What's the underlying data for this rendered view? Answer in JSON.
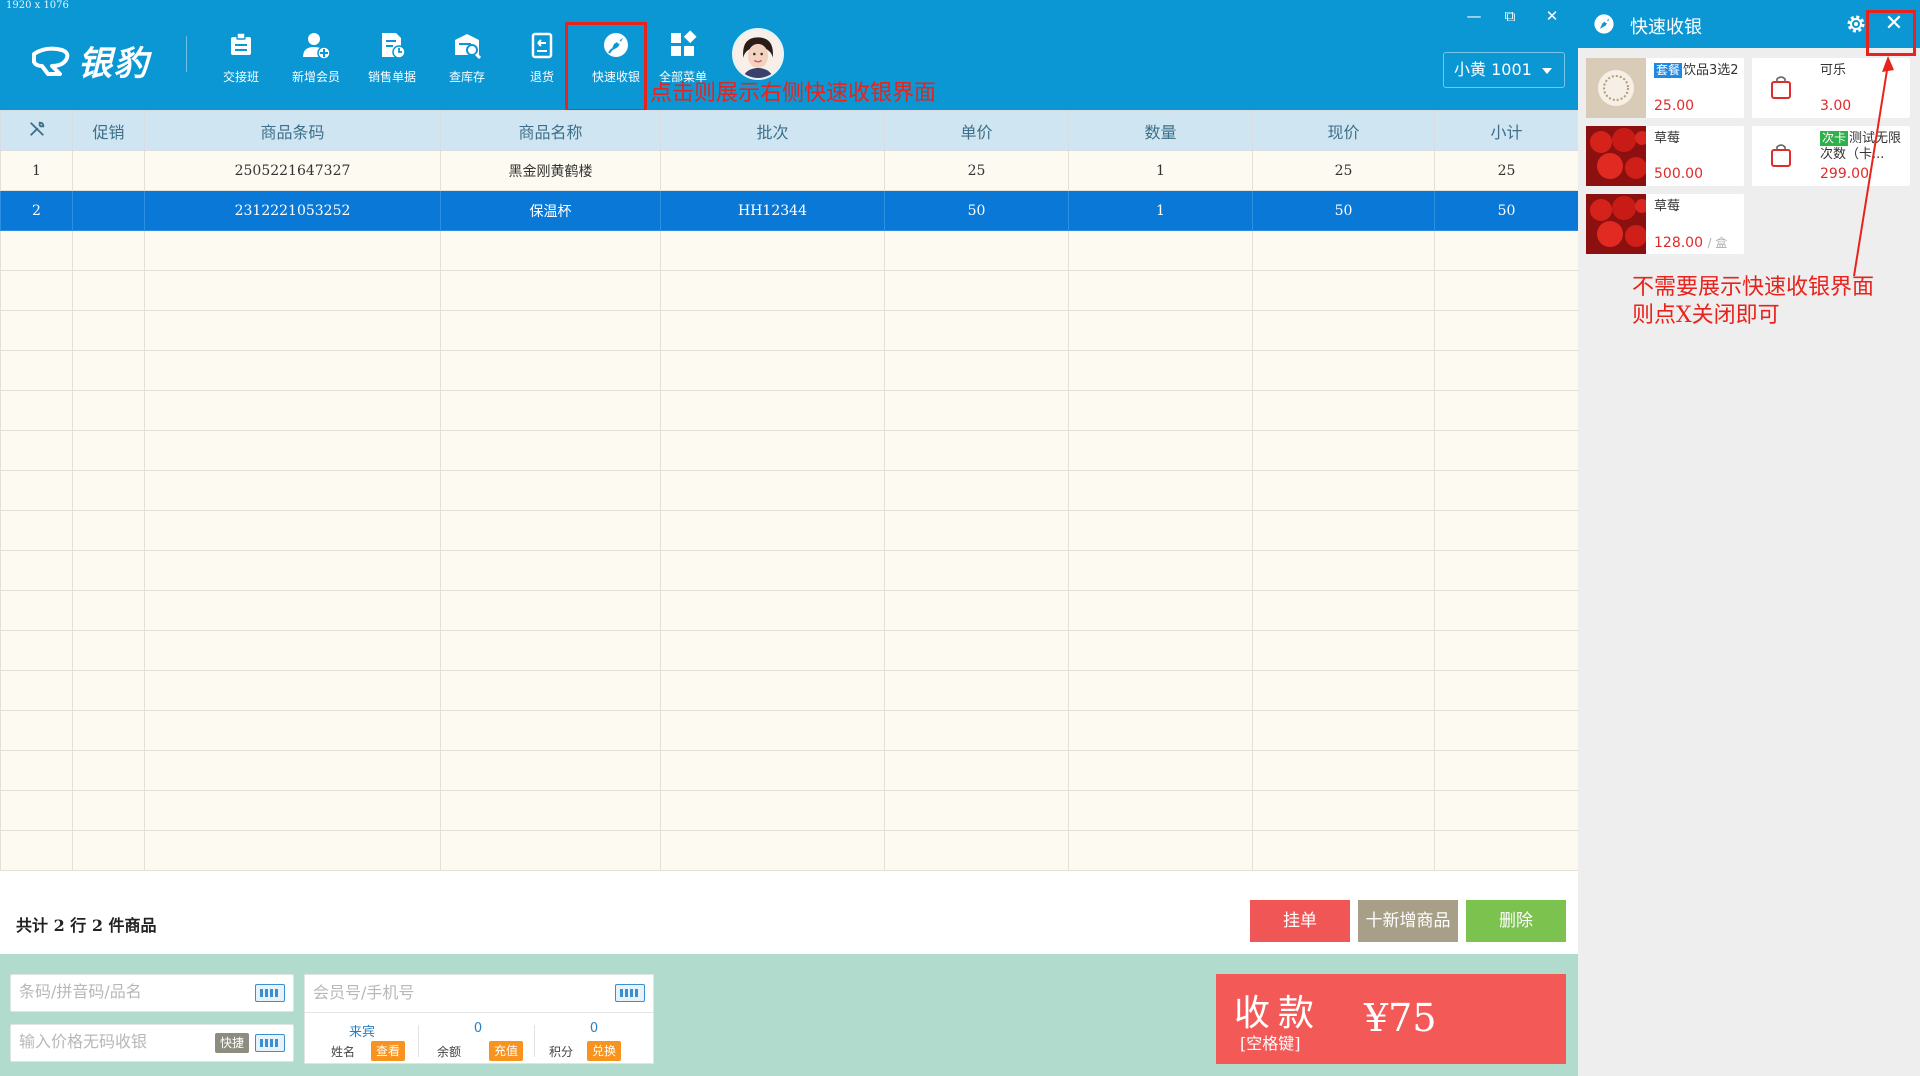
{
  "screen_size_label": "1920 x 1076",
  "brand": {
    "name": "银豹"
  },
  "toolbar": [
    {
      "label": "交接班",
      "icon": "shift-handover-icon"
    },
    {
      "label": "新增会员",
      "icon": "add-member-icon"
    },
    {
      "label": "销售单据",
      "icon": "sales-receipts-icon"
    },
    {
      "label": "查库存",
      "icon": "check-inventory-icon"
    },
    {
      "label": "退货",
      "icon": "return-goods-icon"
    },
    {
      "label": "快速收银",
      "icon": "quick-checkout-icon"
    },
    {
      "label": "全部菜单",
      "icon": "all-menus-icon"
    }
  ],
  "operator": {
    "label": "小黄 1001"
  },
  "window_controls": {
    "minimize": "—",
    "restore": "⧉",
    "close": "✕"
  },
  "annotations": {
    "toolbar_note": "点击则展示右侧快速收银界面",
    "side_note_line1": "不需要展示快速收银界面",
    "side_note_line2": "则点X关闭即可"
  },
  "table": {
    "columns": [
      "促销",
      "商品条码",
      "商品名称",
      "批次",
      "单价",
      "数量",
      "现价",
      "小计"
    ],
    "rows": [
      {
        "no": "1",
        "promo": "",
        "barcode": "2505221647327",
        "name": "黑金刚黄鹤楼",
        "batch": "",
        "price": "25",
        "qty": "1",
        "current": "25",
        "subtotal": "25"
      },
      {
        "no": "2",
        "promo": "",
        "barcode": "2312221053252",
        "name": "保温杯",
        "batch": "HH12344",
        "price": "50",
        "qty": "1",
        "current": "50",
        "subtotal": "50"
      }
    ],
    "selected_row": 2
  },
  "summary": "共计 2 行 2 件商品",
  "actions": {
    "hold": "挂单",
    "add": "十新增商品",
    "delete": "删除"
  },
  "inputs": {
    "barcode_placeholder": "条码/拼音码/品名",
    "price_placeholder": "输入价格无码收银",
    "quick_label": "快捷",
    "member_placeholder": "会员号/手机号"
  },
  "member": {
    "name_value": "来宾",
    "name_label": "姓名",
    "name_btn": "查看",
    "balance_value": "0",
    "balance_label": "余额",
    "balance_btn": "充值",
    "points_value": "0",
    "points_label": "积分",
    "points_btn": "兑换"
  },
  "pay": {
    "title": "收款",
    "hint": "[空格键]",
    "amount": "¥75"
  },
  "quick_panel": {
    "title": "快速收银",
    "products": [
      {
        "tag": "套餐",
        "name": "饮品3选2",
        "price": "25.00",
        "unit": ""
      },
      {
        "tag": "",
        "name": "可乐",
        "price": "3.00",
        "unit": ""
      },
      {
        "tag": "",
        "name": "草莓",
        "price": "500.00",
        "unit": ""
      },
      {
        "tag": "次卡",
        "name": "测试无限次数（卡...",
        "price": "299.00",
        "unit": ""
      },
      {
        "tag": "",
        "name": "草莓",
        "price": "128.00",
        "unit": "/ 盒"
      }
    ]
  },
  "colors": {
    "header": "#0a97d4",
    "selected_row": "#0a78d6",
    "pay": "#f35a57",
    "hold": "#f05656",
    "add": "#a79f87",
    "delete": "#7cc24f",
    "annotation": "#e8221c",
    "tag_combo": "#1e88e5",
    "tag_card": "#2fb14a"
  }
}
